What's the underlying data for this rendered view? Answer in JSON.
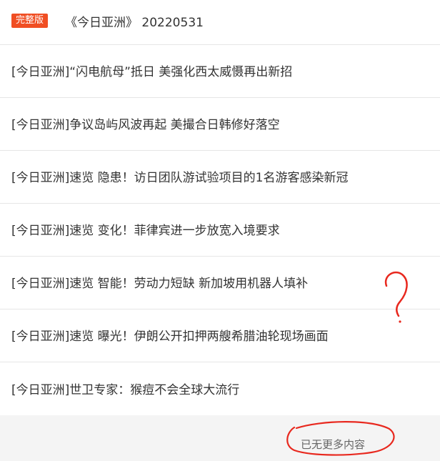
{
  "header": {
    "badge": "完整版",
    "title": "《今日亚洲》 20220531"
  },
  "items": [
    {
      "text": "[今日亚洲]“闪电航母”抵日 美强化西太威慑再出新招"
    },
    {
      "text": "[今日亚洲]争议岛屿风波再起 美撮合日韩修好落空"
    },
    {
      "text": "[今日亚洲]速览 隐患！访日团队游试验项目的1名游客感染新冠"
    },
    {
      "text": "[今日亚洲]速览 变化！菲律宾进一步放宽入境要求"
    },
    {
      "text": "[今日亚洲]速览 智能！劳动力短缺 新加坡用机器人填补"
    },
    {
      "text": "[今日亚洲]速览 曝光！伊朗公开扣押两艘希腊油轮现场画面"
    },
    {
      "text": "[今日亚洲]世卫专家：猴痘不会全球大流行"
    }
  ],
  "footer": {
    "text": "已无更多内容"
  },
  "colors": {
    "badge_bg": "#f04e23",
    "annotation_red": "#e8281e",
    "footer_bg": "#f4f4f4"
  }
}
